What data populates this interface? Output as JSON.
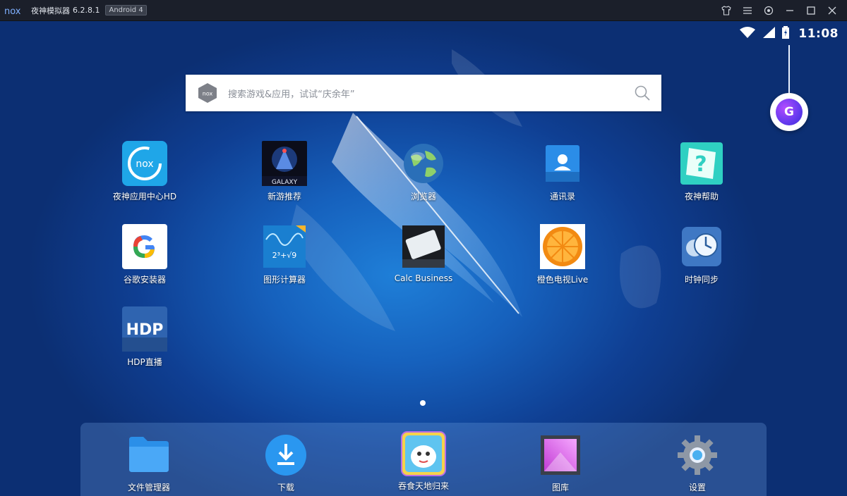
{
  "titlebar": {
    "logo_text": "nox",
    "title": "夜神模拟器",
    "version": "6.2.8.1",
    "android_badge": "Android 4",
    "controls": [
      "shirt-icon",
      "menu-icon",
      "settings-icon",
      "minimize-icon",
      "maximize-icon",
      "close-icon"
    ]
  },
  "statusbar": {
    "time": "11:08",
    "icons": [
      "wifi-icon",
      "signal-icon",
      "battery-icon"
    ]
  },
  "search": {
    "placeholder": "搜索游戏&应用，试试“庆余年”"
  },
  "apps": [
    {
      "label": "夜神应用中心HD",
      "icon": "nox-app-center-icon"
    },
    {
      "label": "新游推荐",
      "icon": "galaxy-game-icon"
    },
    {
      "label": "浏览器",
      "icon": "globe-browser-icon"
    },
    {
      "label": "通讯录",
      "icon": "contacts-icon"
    },
    {
      "label": "夜神帮助",
      "icon": "help-icon"
    },
    {
      "label": "谷歌安装器",
      "icon": "google-installer-icon"
    },
    {
      "label": "图形计算器",
      "icon": "graphing-calculator-icon"
    },
    {
      "label": "Calc Business",
      "icon": "calc-business-icon"
    },
    {
      "label": "橙色电视Live",
      "icon": "orange-tv-icon"
    },
    {
      "label": "时钟同步",
      "icon": "clock-sync-icon"
    },
    {
      "label": "HDP直播",
      "icon": "hdp-icon"
    }
  ],
  "dock": [
    {
      "label": "文件管理器",
      "icon": "folder-icon"
    },
    {
      "label": "下载",
      "icon": "download-icon"
    },
    {
      "label": "吞食天地归来",
      "icon": "game-tunshi-icon"
    },
    {
      "label": "图库",
      "icon": "gallery-icon"
    },
    {
      "label": "设置",
      "icon": "settings-gear-icon"
    }
  ],
  "colors": {
    "titlebar_bg": "#1b1f2a",
    "wallpaper_center": "#1f7fd8",
    "wallpaper_edge": "#0c2f73",
    "assistant_purple": "#6a3bf0"
  }
}
